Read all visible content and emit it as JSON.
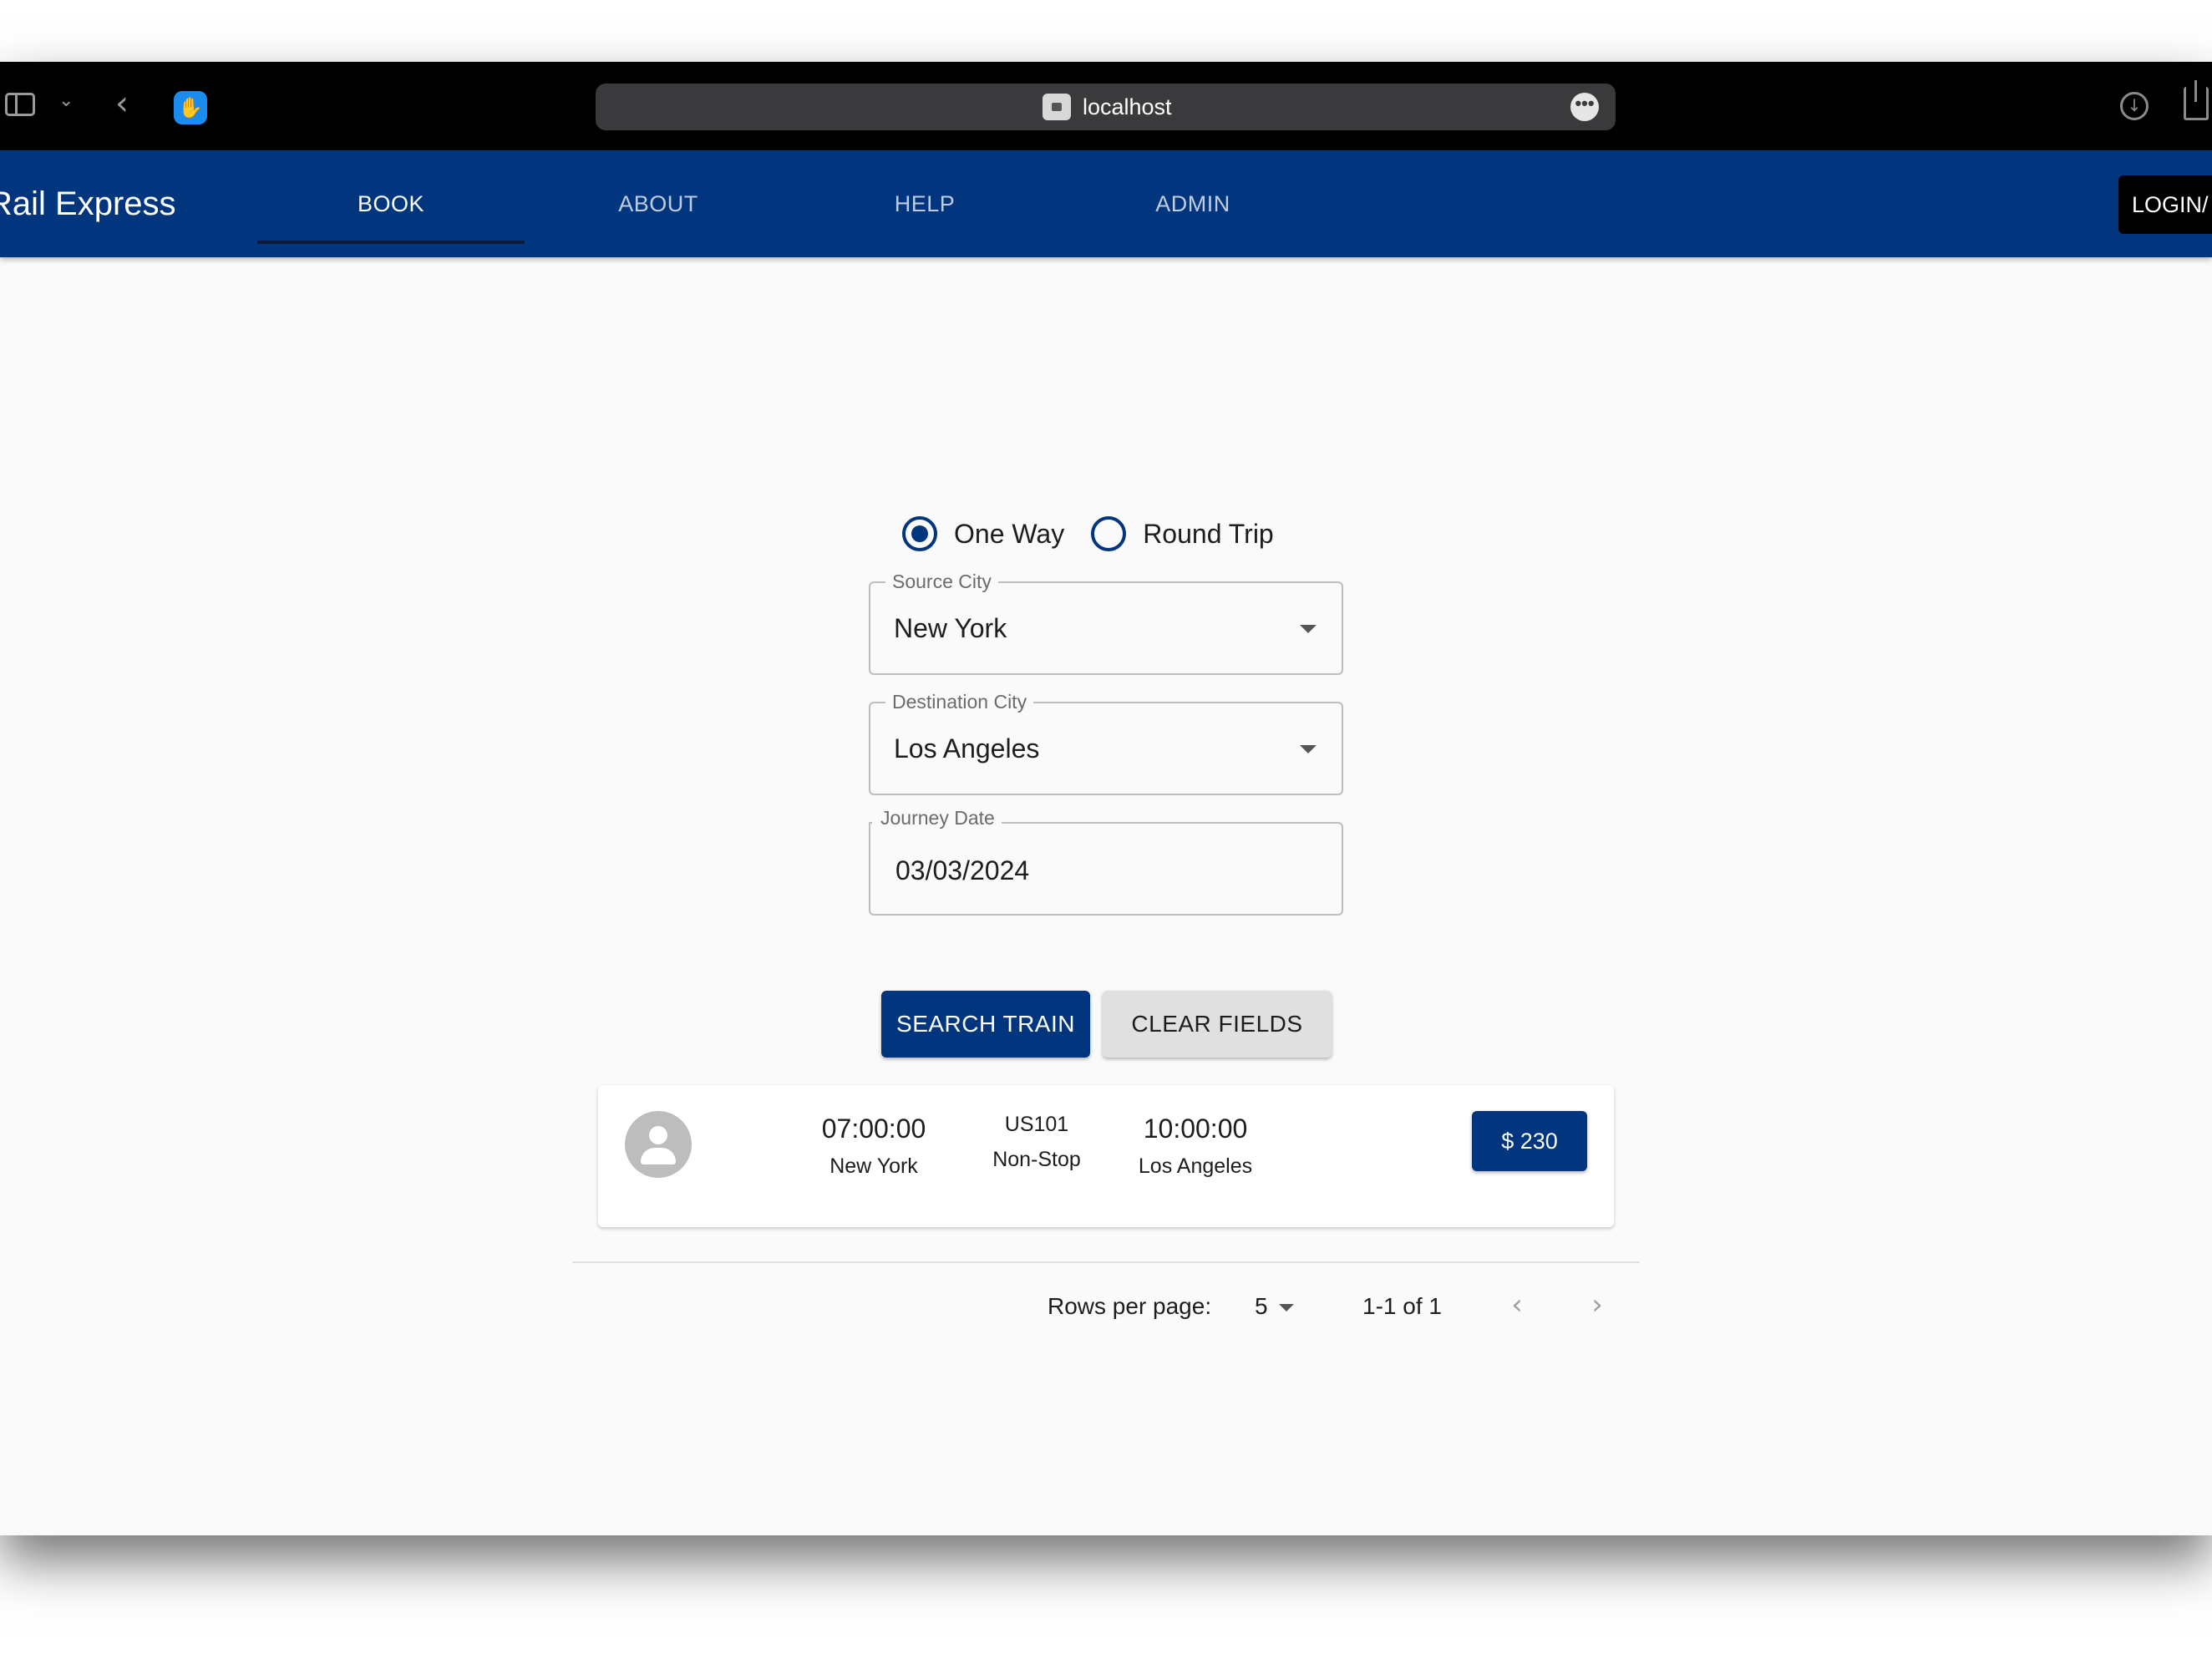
{
  "browser": {
    "url": "localhost",
    "more_glyph": "•••"
  },
  "app": {
    "brand": "Rail Express",
    "nav": [
      "BOOK",
      "ABOUT",
      "HELP",
      "ADMIN"
    ],
    "login_label": "LOGIN/"
  },
  "form": {
    "trip_types": [
      {
        "label": "One Way",
        "checked": true
      },
      {
        "label": "Round Trip",
        "checked": false
      }
    ],
    "source_label": "Source City",
    "source_value": "New York",
    "destination_label": "Destination City",
    "destination_value": "Los Angeles",
    "date_label": "Journey Date",
    "date_value": "03/03/2024",
    "search_label": "SEARCH TRAIN",
    "clear_label": "CLEAR FIELDS"
  },
  "results": [
    {
      "depart_time": "07:00:00",
      "depart_city": "New York",
      "train": "US101",
      "stops": "Non-Stop",
      "arrive_time": "10:00:00",
      "arrive_city": "Los Angeles",
      "price": "$ 230"
    }
  ],
  "pagination": {
    "rows_label": "Rows per page:",
    "rows_value": "5",
    "range": "1-1 of 1",
    "prev_glyph": "‹",
    "next_glyph": "›"
  },
  "colors": {
    "primary": "#01367f",
    "app_bar": "#01367f",
    "page_bg": "#fafafa"
  }
}
